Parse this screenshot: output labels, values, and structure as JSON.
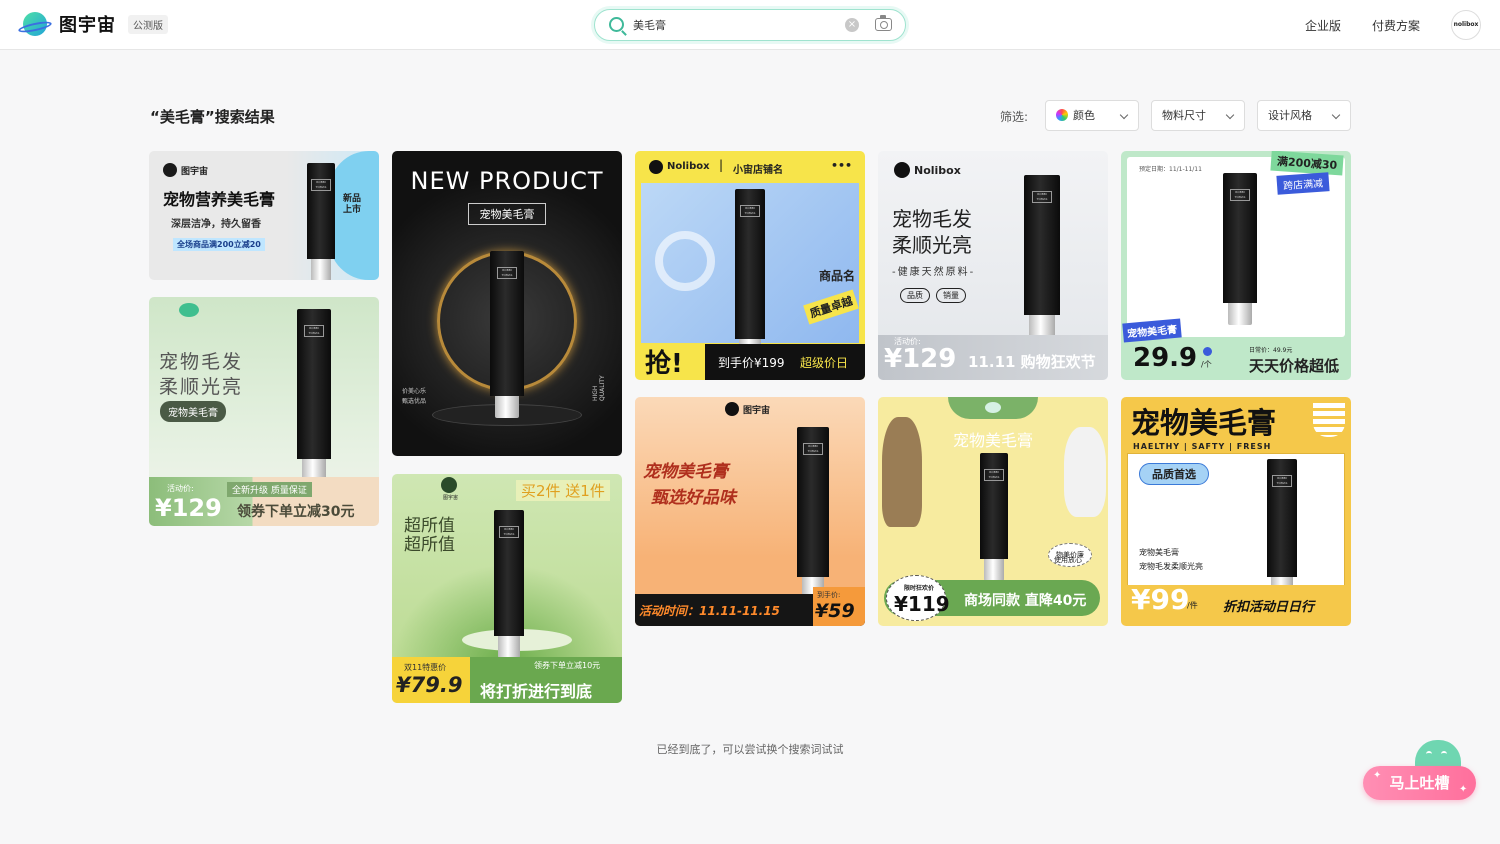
{
  "header": {
    "brand": "图宇宙",
    "beta_badge": "公测版",
    "search_value": "美毛膏",
    "clear_glyph": "×",
    "nav": [
      "企业版",
      "付费方案"
    ],
    "avatar_text": "nolibox"
  },
  "results": {
    "title": "“美毛膏”搜索结果",
    "filter_label": "筛选:",
    "filters": [
      "颜色",
      "物料尺寸",
      "设计风格"
    ]
  },
  "cards": {
    "c1": {
      "brand": "图宇宙",
      "title": "宠物营养美毛膏",
      "sub": "深层洁净，持久留香",
      "promo": "全场商品满200立减20",
      "badge1": "新品",
      "badge2": "上市"
    },
    "c2": {
      "t1": "宠物毛发",
      "t2": "柔顺光亮",
      "tag": "宠物美毛膏",
      "price_label": "活动价:",
      "price": "¥129",
      "upgrade": "全新升级 质量保证",
      "coupon": "领券下单立减30元"
    },
    "c3": {
      "t1": "NEW PRODUCT",
      "t2": "宠物美毛膏",
      "side1": "价美心乐",
      "side2": "甄选优品",
      "vertical": "HIGH QUALITY"
    },
    "c4": {
      "brand_top": "图宇宙",
      "promo": "买2件 送1件",
      "t1": "超所值",
      "t2": "超所值",
      "price_label": "双11特惠价",
      "price": "¥79.9",
      "coupon": "领券下单立减10元",
      "sale": "将打折进行到底"
    },
    "c5": {
      "brand": "Nolibox",
      "shop": "小宙店铺名",
      "more": "•••",
      "name": "商品名",
      "quality": "质量卓越",
      "grab": "抢!",
      "price": "到手价¥199",
      "day": "超级价日"
    },
    "c6": {
      "brand": "图宇宙",
      "t1": "宠物美毛膏",
      "t2": "甄选好品味",
      "time": "活动时间：11.11-11.15",
      "price_label": "到手价:",
      "price": "¥59"
    },
    "c7": {
      "brand": "Nolibox",
      "t1": "宠物毛发",
      "t2": "柔顺光亮",
      "t3": "-健康天然原料-",
      "pill1": "品质",
      "pill2": "销量",
      "price_label": "活动价:",
      "price": "¥129",
      "event": "11.11 购物狂欢节"
    },
    "c8": {
      "title": "宠物美毛膏",
      "bubble1": "物美价廉",
      "bubble2": "使用放心",
      "price_label": "限时狂欢价",
      "price": "¥119",
      "desc": "商场同款 直降40元"
    },
    "c9": {
      "date": "预定日期：11/1-11/11",
      "tag1": "满200减30",
      "tag2": "跨店满减",
      "tag3": "宠物美毛膏",
      "price": "29.9",
      "unit": "/个",
      "daily_label": "日常价：49.9元",
      "daily": "天天价格超低"
    },
    "c10": {
      "title": "宠物美毛膏",
      "sub": "HAELTHY | SAFTY | FRESH",
      "badge": "品质首选",
      "d1": "宠物美毛膏",
      "d2": "宠物毛发柔顺光亮",
      "price": "¥99",
      "unit": "/件",
      "sale": "折扣活动日日行"
    }
  },
  "product_label": "ROBBI TOMAS",
  "footer": "已经到底了，可以尝试换个搜索词试试",
  "feedback": "马上吐槽"
}
